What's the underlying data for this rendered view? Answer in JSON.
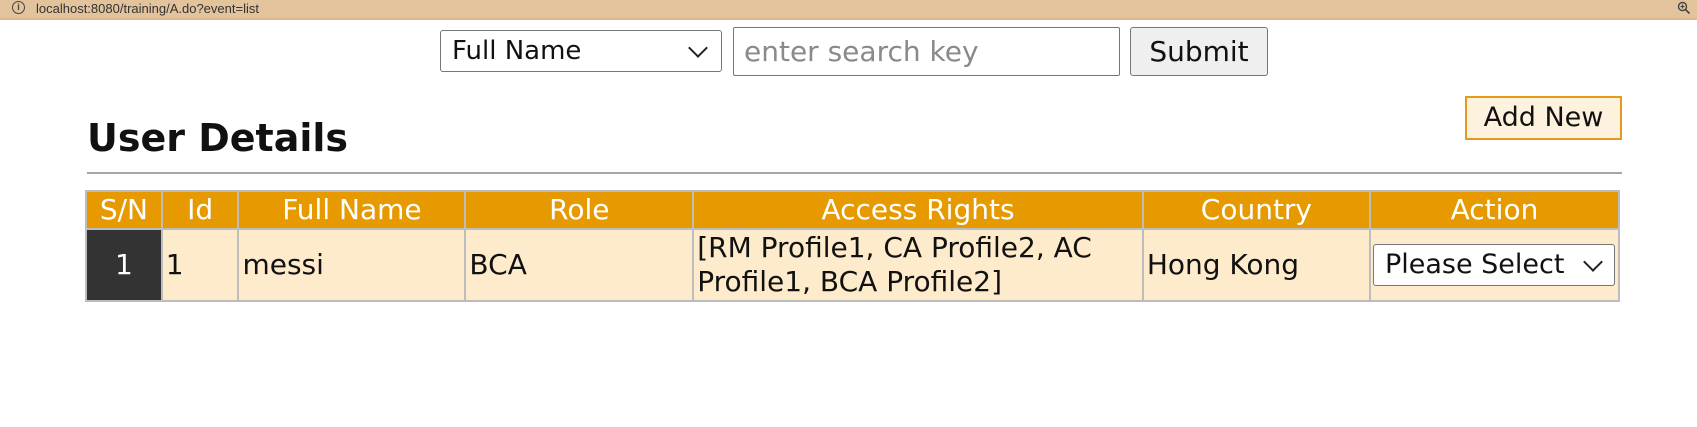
{
  "browser": {
    "url": "localhost:8080/training/A.do?event=list"
  },
  "search": {
    "field_selected": "Full Name",
    "placeholder": "enter search key",
    "submit_label": "Submit"
  },
  "page": {
    "add_new_label": "Add New",
    "title": "User Details"
  },
  "table": {
    "headers": [
      "S/N",
      "Id",
      "Full Name",
      "Role",
      "Access Rights",
      "Country",
      "Action"
    ],
    "rows": [
      {
        "sn": "1",
        "id": "1",
        "full_name": "messi",
        "role": "BCA",
        "access_rights": "[RM Profile1, CA Profile2, AC Profile1, BCA Profile2]",
        "country": "Hong Kong",
        "action_selected": "Please Select"
      }
    ]
  },
  "colors": {
    "header_bg": "#e69a00",
    "row_bg": "#fdebcc",
    "urlbar_bg": "#e2c39c"
  },
  "icons": [
    "info-icon",
    "zoom-icon",
    "chevron-down-icon"
  ]
}
